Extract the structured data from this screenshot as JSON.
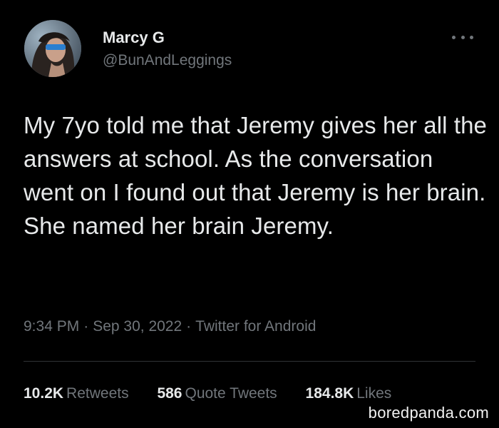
{
  "author": {
    "display_name": "Marcy G",
    "handle": "@BunAndLeggings"
  },
  "tweet": {
    "text": "My 7yo told me that Jeremy gives her all the answers at school. As the conversation went on I found out that Jeremy is her brain. She named her brain Jeremy."
  },
  "meta": {
    "time": "9:34 PM",
    "date": "Sep 30, 2022",
    "source": "Twitter for Android",
    "separator": "·"
  },
  "stats": {
    "retweets_count": "10.2K",
    "retweets_label": "Retweets",
    "quotes_count": "586",
    "quotes_label": "Quote Tweets",
    "likes_count": "184.8K",
    "likes_label": "Likes"
  },
  "watermark": "boredpanda.com",
  "icons": {
    "more": "more-options-icon"
  }
}
